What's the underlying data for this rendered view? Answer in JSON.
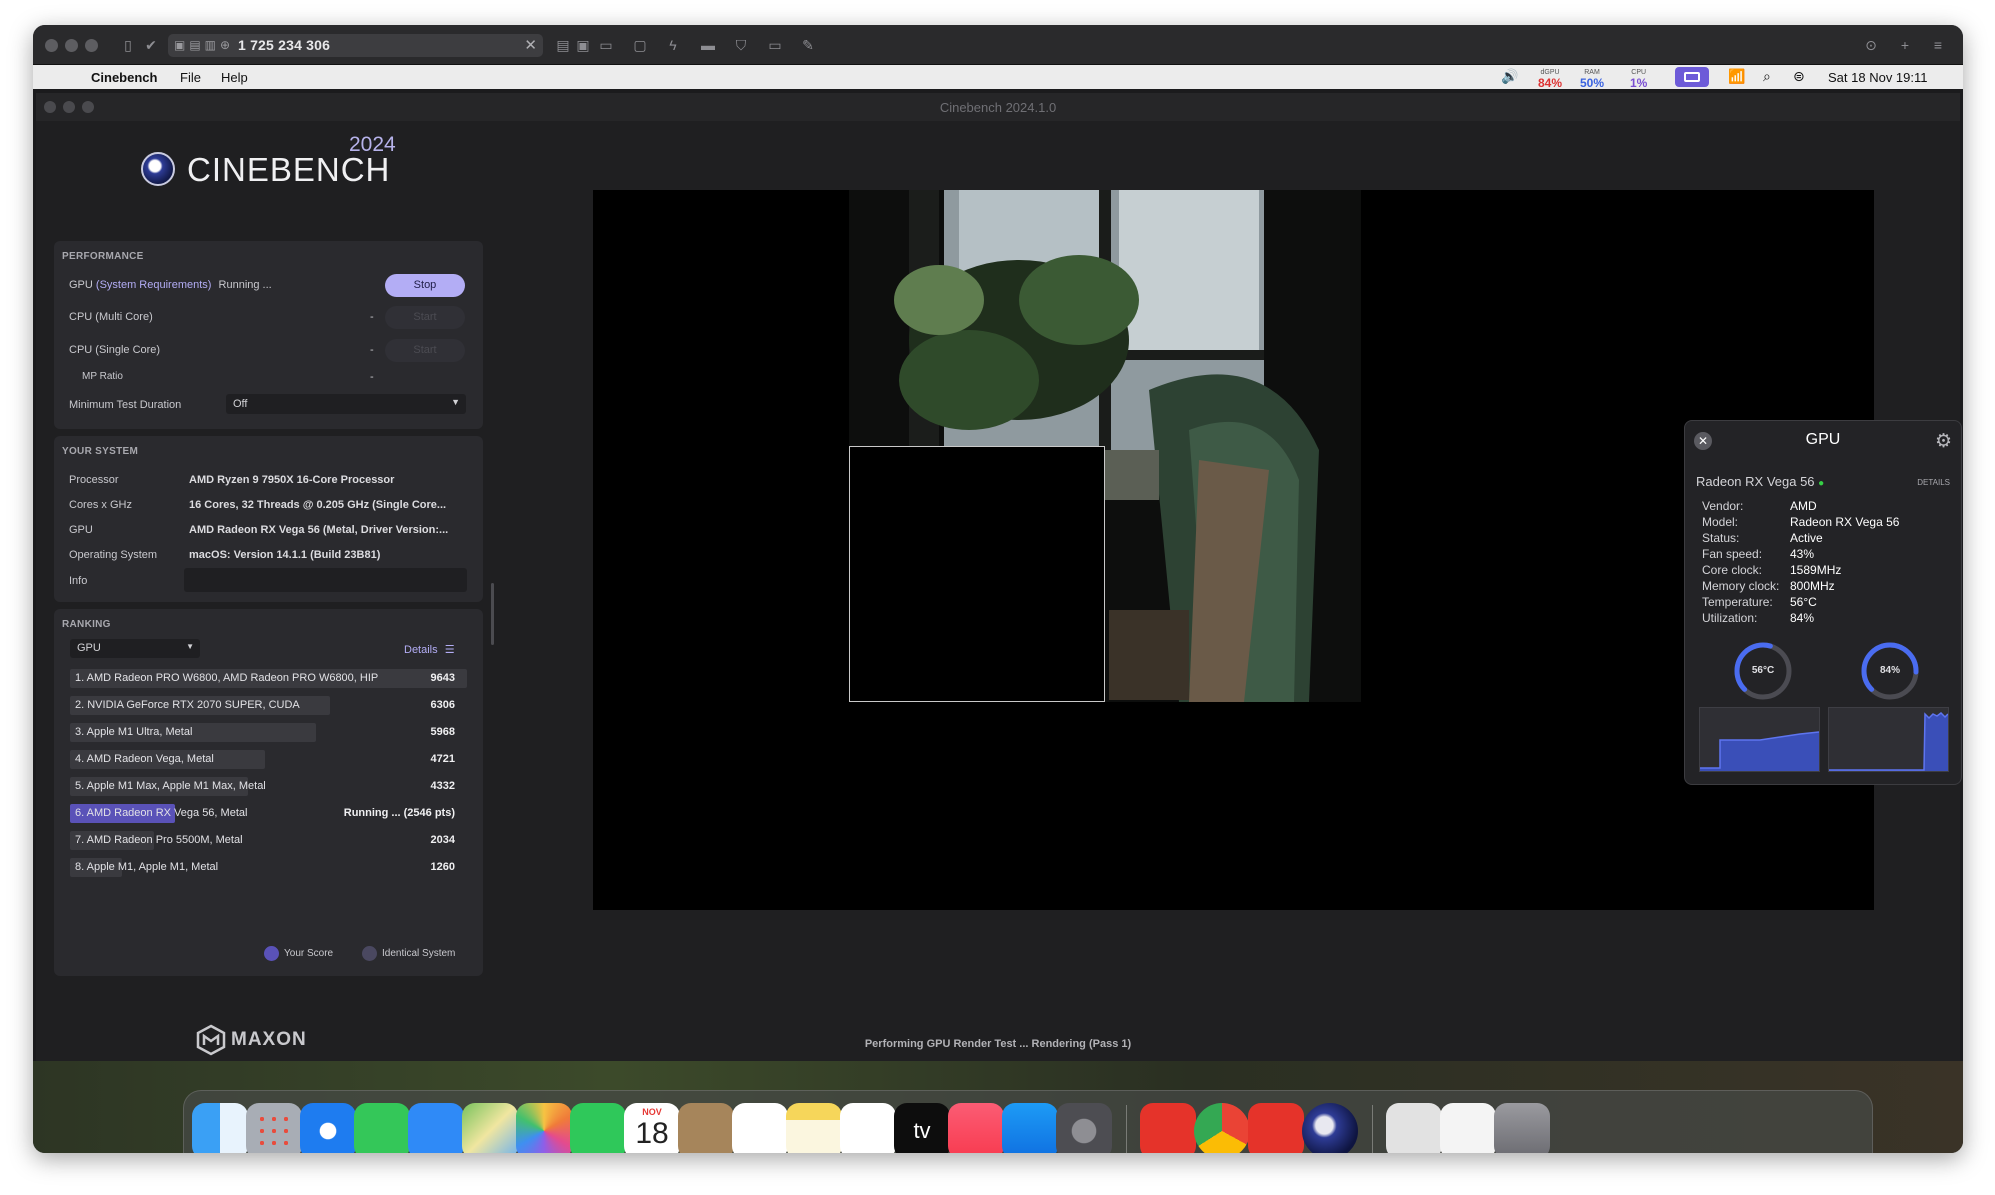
{
  "toolbar": {
    "address": "1 725 234 306"
  },
  "menubar": {
    "app_name": "Cinebench",
    "file": "File",
    "help": "Help",
    "dgpu_label": "dGPU",
    "dgpu_value": "84%",
    "ram_label": "RAM",
    "ram_value": "50%",
    "cpu_label": "CPU",
    "cpu_value": "1%",
    "datetime": "Sat 18 Nov  19:11"
  },
  "window": {
    "title": "Cinebench 2024.1.0"
  },
  "logo": {
    "name": "CINEBENCH",
    "year": "2024"
  },
  "performance": {
    "title": "PERFORMANCE",
    "gpu_label": "GPU",
    "gpu_req": "(System Requirements)",
    "gpu_status": "Running ...",
    "stop_label": "Stop",
    "cpu_multi_label": "CPU (Multi Core)",
    "cpu_multi_value": "-",
    "cpu_single_label": "CPU (Single Core)",
    "cpu_single_value": "-",
    "start_label": "Start",
    "mp_ratio_label": "MP Ratio",
    "mp_ratio_value": "-",
    "min_duration_label": "Minimum Test Duration",
    "min_duration_value": "Off"
  },
  "system": {
    "title": "YOUR SYSTEM",
    "rows": [
      {
        "label": "Processor",
        "value": "AMD Ryzen 9 7950X 16-Core Processor"
      },
      {
        "label": "Cores x GHz",
        "value": "16 Cores, 32 Threads @ 0.205 GHz (Single Core..."
      },
      {
        "label": "GPU",
        "value": "AMD Radeon RX Vega 56 (Metal, Driver Version:..."
      },
      {
        "label": "Operating System",
        "value": "macOS: Version 14.1.1 (Build 23B81)"
      },
      {
        "label": "Info",
        "value": ""
      }
    ]
  },
  "ranking": {
    "title": "RANKING",
    "filter": "GPU",
    "details": "Details",
    "items": [
      {
        "label": "1. AMD Radeon PRO W6800, AMD Radeon PRO W6800, HIP",
        "value": "9643",
        "fraction": 1.0
      },
      {
        "label": "2. NVIDIA GeForce RTX 2070 SUPER, CUDA",
        "value": "6306",
        "fraction": 0.654
      },
      {
        "label": "3. Apple M1 Ultra, Metal",
        "value": "5968",
        "fraction": 0.619
      },
      {
        "label": "4. AMD Radeon Vega, Metal",
        "value": "4721",
        "fraction": 0.49
      },
      {
        "label": "5. Apple M1 Max, Apple M1 Max, Metal",
        "value": "4332",
        "fraction": 0.449
      },
      {
        "label": "6. AMD Radeon RX Vega 56, Metal",
        "value": "Running ... (2546 pts)",
        "fraction": 0.264
      },
      {
        "label": "7. AMD Radeon Pro 5500M, Metal",
        "value": "2034",
        "fraction": 0.211
      },
      {
        "label": "8. Apple M1, Apple M1, Metal",
        "value": "1260",
        "fraction": 0.131
      }
    ],
    "legend_your_score": "Your Score",
    "legend_identical": "Identical System"
  },
  "brand": {
    "maxon": "MAXON"
  },
  "render_status": "Performing GPU Render Test ... Rendering (Pass 1)",
  "gpu_widget": {
    "title": "GPU",
    "device": "Radeon RX Vega 56",
    "details": "DETAILS",
    "rows": [
      {
        "label": "Vendor:",
        "value": "AMD"
      },
      {
        "label": "Model:",
        "value": "Radeon RX Vega 56"
      },
      {
        "label": "Status:",
        "value": "Active"
      },
      {
        "label": "Fan speed:",
        "value": "43%"
      },
      {
        "label": "Core clock:",
        "value": "1589MHz"
      },
      {
        "label": "Memory clock:",
        "value": "800MHz"
      },
      {
        "label": "Temperature:",
        "value": "56°C"
      },
      {
        "label": "Utilization:",
        "value": "84%"
      }
    ],
    "temp_gauge": "56°C",
    "temp_fraction": 0.56,
    "util_gauge": "84%",
    "util_fraction": 0.84
  },
  "dock": {
    "calendar_month": "NOV",
    "calendar_day": "18",
    "tv_label": "tv"
  },
  "colors": {
    "accent": "#b3adf5",
    "highlight_bar": "#5a52b8",
    "gauge": "#4a6cf0"
  }
}
